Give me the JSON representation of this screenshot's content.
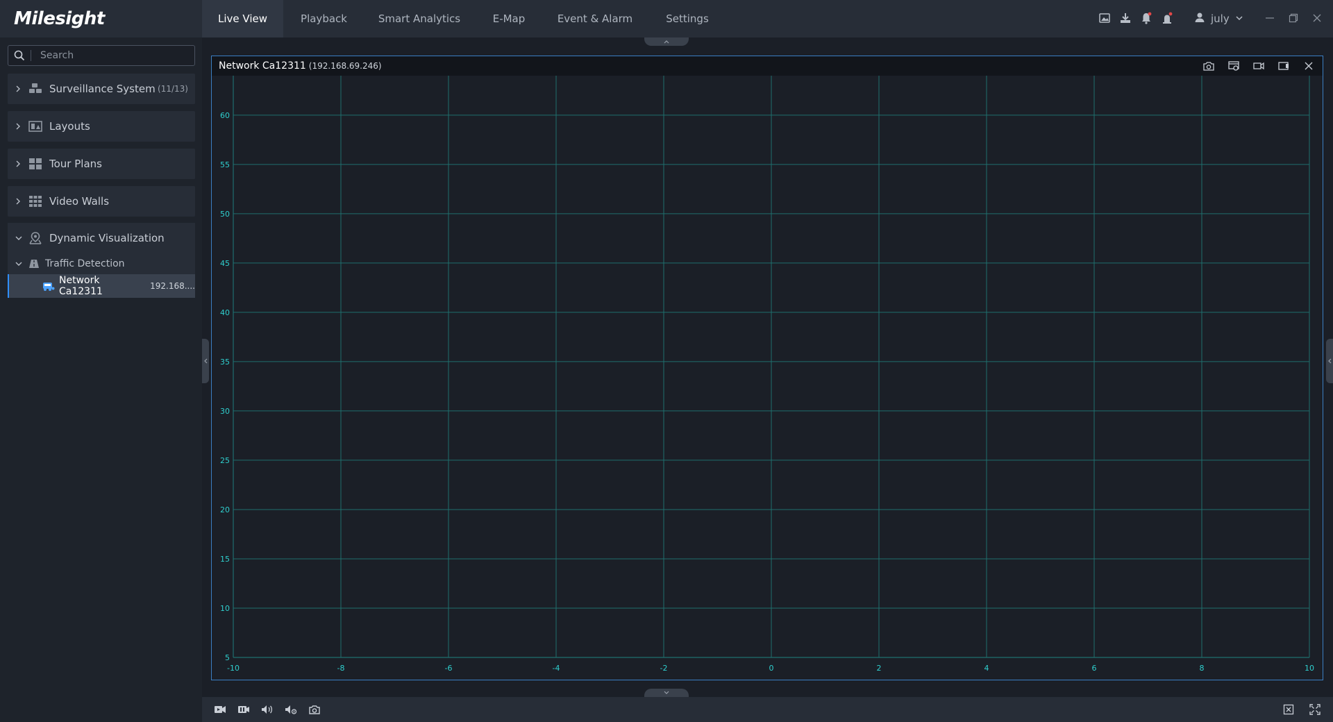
{
  "app": {
    "logo": "Milesight"
  },
  "nav": {
    "tabs": [
      {
        "label": "Live View",
        "active": true
      },
      {
        "label": "Playback",
        "active": false
      },
      {
        "label": "Smart Analytics",
        "active": false
      },
      {
        "label": "E-Map",
        "active": false
      },
      {
        "label": "Event & Alarm",
        "active": false
      },
      {
        "label": "Settings",
        "active": false
      }
    ]
  },
  "header": {
    "icons": [
      "image-icon",
      "download-icon",
      "bell-icon",
      "alarm-icon"
    ],
    "user": "july"
  },
  "sidebar": {
    "search_placeholder": "Search",
    "groups": [
      {
        "label": "Surveillance System",
        "count": "(11/13)",
        "icon": "surveillance-icon"
      },
      {
        "label": "Layouts",
        "icon": "layouts-icon"
      },
      {
        "label": "Tour Plans",
        "icon": "tour-plans-icon"
      },
      {
        "label": "Video Walls",
        "icon": "video-walls-icon"
      }
    ],
    "dynamic": {
      "label": "Dynamic Visualization",
      "sub": "Traffic Detection",
      "camera": {
        "name": "Network Ca12311",
        "ip": "192.168...."
      }
    }
  },
  "panel": {
    "title": "Network Ca12311",
    "ip": "(192.168.69.246)"
  },
  "colors": {
    "grid": "#1f6f6e",
    "tick_label": "#2fd0cf",
    "accent": "#3b7fc4"
  },
  "chart_data": {
    "type": "scatter",
    "x_ticks": [
      -10,
      -8,
      -6,
      -4,
      -2,
      0,
      2,
      4,
      6,
      8,
      10
    ],
    "y_ticks": [
      5,
      10,
      15,
      20,
      25,
      30,
      35,
      40,
      45,
      50,
      55,
      60
    ],
    "xlim": [
      -10,
      10
    ],
    "ylim": [
      5,
      64
    ],
    "grid": true,
    "series": []
  }
}
